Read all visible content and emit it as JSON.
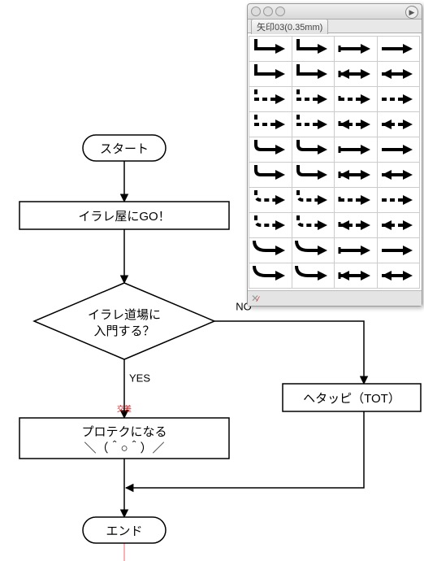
{
  "palette": {
    "tab_label": "矢印03(0.35mm)",
    "footer_icon": "scissors-icon"
  },
  "flowchart": {
    "start": "スタート",
    "step1": "イラレ屋にGO！",
    "decision": {
      "line1": "イラレ道場に",
      "line2": "入門する？"
    },
    "yes": "YES",
    "no": "NO",
    "branch_right": "ヘタッピ（TOT）",
    "step2": {
      "line1": "プロテクになる",
      "line2": "＼（＾○＾）／"
    },
    "end": "エンド",
    "guide_marker": "交差"
  }
}
